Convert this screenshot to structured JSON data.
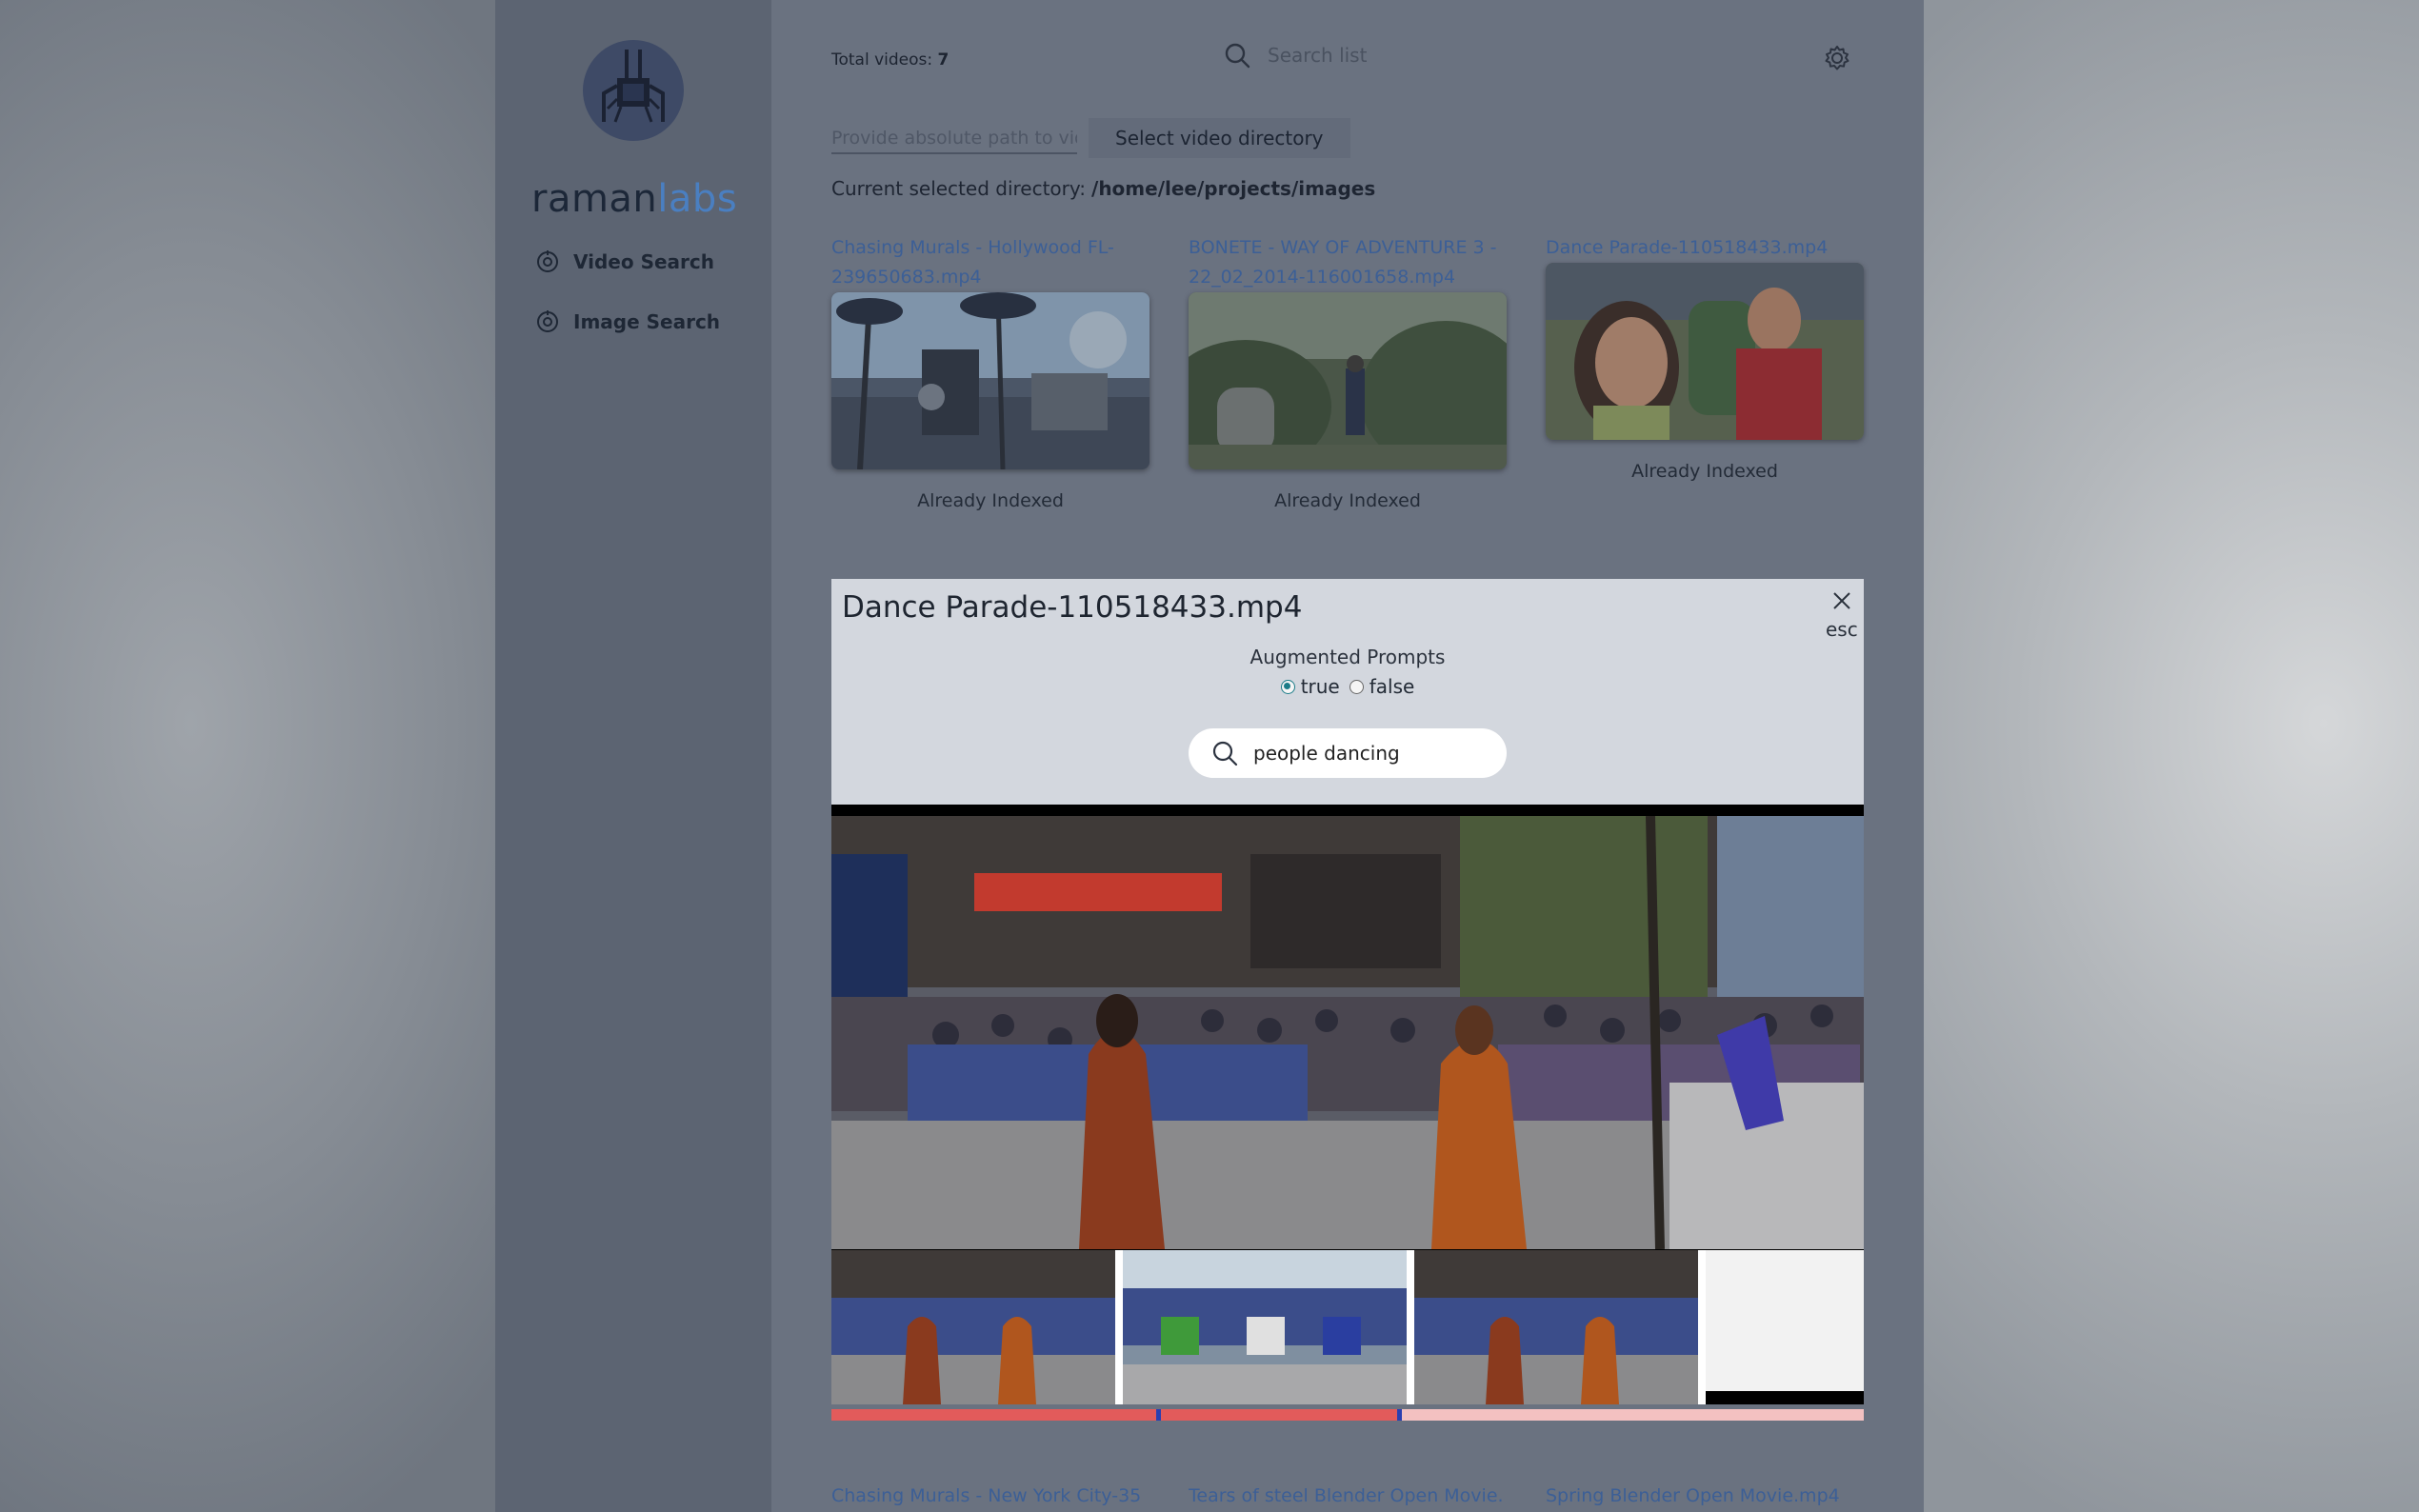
{
  "brand": {
    "part1": "raman",
    "part2": "labs"
  },
  "sidebar": {
    "items": [
      {
        "label": "Video Search",
        "icon": "scan-icon"
      },
      {
        "label": "Image Search",
        "icon": "scan-icon"
      }
    ]
  },
  "header": {
    "total_label": "Total videos:",
    "total_count": "7",
    "search_placeholder": "Search list"
  },
  "directory": {
    "path_placeholder": "Provide absolute path to video directory",
    "select_label": "Select video directory",
    "current_label": "Current selected directory:",
    "current_value": "/home/lee/projects/images"
  },
  "videos": [
    {
      "title": "Chasing Murals - Hollywood FL-239650683.mp4",
      "status": "Already Indexed"
    },
    {
      "title": "BONETE - WAY OF ADVENTURE 3 - 22_02_2014-116001658.mp4",
      "status": "Already Indexed"
    },
    {
      "title": "Dance Parade-110518433.mp4",
      "status": "Already Indexed"
    }
  ],
  "bottom_videos": [
    {
      "title": "Chasing Murals - New York City-35"
    },
    {
      "title": "Tears of steel Blender Open Movie."
    },
    {
      "title": "Spring Blender Open Movie.mp4"
    }
  ],
  "modal": {
    "title": "Dance Parade-110518433.mp4",
    "close_hint": "esc",
    "aug_label": "Augmented Prompts",
    "option_true": "true",
    "option_false": "false",
    "selected": "true",
    "query": "people dancing"
  },
  "progress": {
    "segments": [
      {
        "start": 0.0,
        "end": 0.315
      },
      {
        "start": 0.318,
        "end": 0.548
      }
    ],
    "markers": [
      0.315,
      0.548
    ]
  },
  "colors": {
    "accent": "#4a7fc1",
    "link": "#3c5f96",
    "progress": "#e25b5b",
    "marker": "#2b3fb0"
  }
}
